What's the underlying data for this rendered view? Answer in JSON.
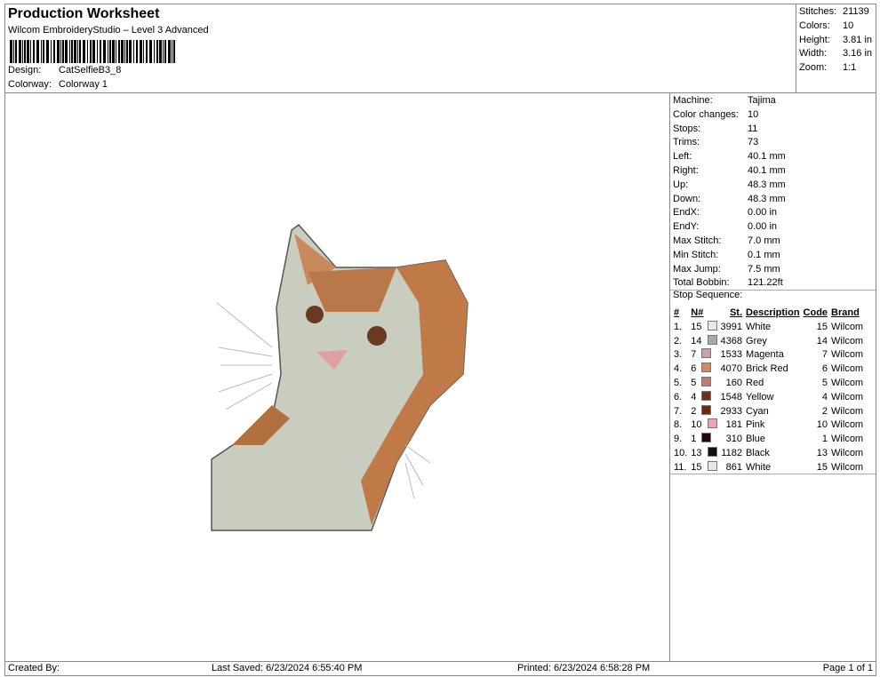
{
  "header": {
    "title": "Production Worksheet",
    "subtitle": "Wilcom EmbroideryStudio – Level 3 Advanced",
    "design_label": "Design:",
    "design": "CatSelfieB3_8",
    "colorway_label": "Colorway:",
    "colorway": "Colorway 1"
  },
  "summary": [
    {
      "k": "Stitches:",
      "v": "21139"
    },
    {
      "k": "Colors:",
      "v": "10"
    },
    {
      "k": "Height:",
      "v": "3.81 in"
    },
    {
      "k": "Width:",
      "v": "3.16 in"
    },
    {
      "k": "Zoom:",
      "v": "1:1"
    }
  ],
  "machine": [
    {
      "k": "Machine:",
      "v": "Tajima"
    },
    {
      "k": "Color changes:",
      "v": "10"
    },
    {
      "k": "Stops:",
      "v": "11"
    },
    {
      "k": "Trims:",
      "v": "73"
    },
    {
      "k": "Left:",
      "v": "40.1 mm"
    },
    {
      "k": "Right:",
      "v": "40.1 mm"
    },
    {
      "k": "Up:",
      "v": "48.3 mm"
    },
    {
      "k": "Down:",
      "v": "48.3 mm"
    },
    {
      "k": "EndX:",
      "v": "0.00 in"
    },
    {
      "k": "EndY:",
      "v": "0.00 in"
    },
    {
      "k": "Max Stitch:",
      "v": "7.0 mm"
    },
    {
      "k": "Min Stitch:",
      "v": "0.1 mm"
    },
    {
      "k": "Max Jump:",
      "v": "7.5 mm"
    },
    {
      "k": "Total Bobbin:",
      "v": "121.22ft"
    }
  ],
  "stop_sequence": {
    "label": "Stop Sequence:",
    "columns": [
      "#",
      "N#",
      "St.",
      "Description",
      "Code",
      "Brand"
    ],
    "rows": [
      {
        "n": "1.",
        "nn": "15",
        "color": "#e8e8e8",
        "st": "3991",
        "desc": "White",
        "code": "15",
        "brand": "Wilcom"
      },
      {
        "n": "2.",
        "nn": "14",
        "color": "#a8a8a8",
        "st": "4368",
        "desc": "Grey",
        "code": "14",
        "brand": "Wilcom"
      },
      {
        "n": "3.",
        "nn": "7",
        "color": "#c8a0aa",
        "st": "1533",
        "desc": "Magenta",
        "code": "7",
        "brand": "Wilcom"
      },
      {
        "n": "4.",
        "nn": "6",
        "color": "#d08860",
        "st": "4070",
        "desc": "Brick Red",
        "code": "6",
        "brand": "Wilcom"
      },
      {
        "n": "5.",
        "nn": "5",
        "color": "#c07878",
        "st": "160",
        "desc": "Red",
        "code": "5",
        "brand": "Wilcom"
      },
      {
        "n": "6.",
        "nn": "4",
        "color": "#6a3020",
        "st": "1548",
        "desc": "Yellow",
        "code": "4",
        "brand": "Wilcom"
      },
      {
        "n": "7.",
        "nn": "2",
        "color": "#6a2a10",
        "st": "2933",
        "desc": "Cyan",
        "code": "2",
        "brand": "Wilcom"
      },
      {
        "n": "8.",
        "nn": "10",
        "color": "#f0a0b0",
        "st": "181",
        "desc": "Pink",
        "code": "10",
        "brand": "Wilcom"
      },
      {
        "n": "9.",
        "nn": "1",
        "color": "#200808",
        "st": "310",
        "desc": "Blue",
        "code": "1",
        "brand": "Wilcom"
      },
      {
        "n": "10.",
        "nn": "13",
        "color": "#101010",
        "st": "1182",
        "desc": "Black",
        "code": "13",
        "brand": "Wilcom"
      },
      {
        "n": "11.",
        "nn": "15",
        "color": "#e8e8e8",
        "st": "861",
        "desc": "White",
        "code": "15",
        "brand": "Wilcom"
      }
    ]
  },
  "footer": {
    "created": "Created By:",
    "saved": "Last Saved: 6/23/2024 6:55:40 PM",
    "printed": "Printed: 6/23/2024 6:58:28 PM",
    "page": "Page 1 of 1"
  }
}
